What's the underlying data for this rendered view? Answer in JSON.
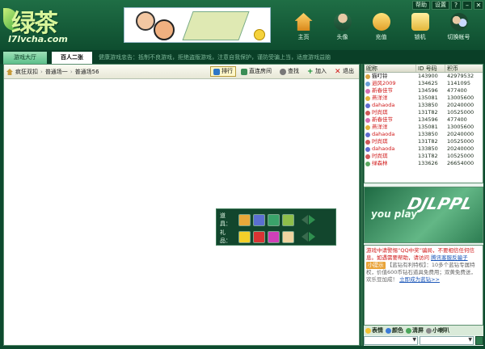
{
  "header": {
    "logo_text": "绿茶",
    "logo_url": "l7lvcha.com",
    "top_buttons": [
      "帮助",
      "设置"
    ],
    "window_controls": [
      "?",
      "–",
      "✕"
    ],
    "nav": [
      {
        "label": "主页",
        "icon": "home-icon"
      },
      {
        "label": "头像",
        "icon": "avatar-icon"
      },
      {
        "label": "充值",
        "icon": "money-bag-icon"
      },
      {
        "label": "锁机",
        "icon": "lock-icon"
      },
      {
        "label": "切换帐号",
        "icon": "switch-account-icon"
      }
    ]
  },
  "tabs": {
    "lobby": "游戏大厅",
    "current": "百人二张",
    "notice": "健康游戏忠告：抵制不良游戏，拒绝盗版游戏，注意自我保护，谨防受骗上当，适度游戏益脑"
  },
  "breadcrumb": [
    "疯狂双扣",
    "普通场一",
    "普通场56"
  ],
  "toolbar": {
    "rank": "排行",
    "direct_join": "直连房间",
    "find": "查找",
    "add": "加入",
    "exit": "退出"
  },
  "items": {
    "props_label": "道具：",
    "gifts_label": "礼品：",
    "props_colors": [
      "#e9a83a",
      "#5a6fd1",
      "#3aa36a",
      "#8fbf4a"
    ],
    "gifts_colors": [
      "#f3d02a",
      "#d83434",
      "#d040b8",
      "#f0d4a0"
    ]
  },
  "players": {
    "columns": [
      "昵称",
      "ID 号码",
      "积币"
    ],
    "rows": [
      {
        "name": "猫叮铃",
        "id": "143900",
        "coins": "42979532",
        "color": "#000000",
        "av": "#d9a444"
      },
      {
        "name": "逍风2009",
        "id": "134625",
        "coins": "1141095",
        "color": "#d01818",
        "av": "#6aa0d8"
      },
      {
        "name": "新春佳节",
        "id": "134596",
        "coins": "477400",
        "color": "#d01818",
        "av": "#d56fb0"
      },
      {
        "name": "燕洋洋",
        "id": "135081",
        "coins": "13005600",
        "color": "#d01818",
        "av": "#e3b23a"
      },
      {
        "name": "dahaoda",
        "id": "133850",
        "coins": "20240000",
        "color": "#d01818",
        "av": "#5f6bcf"
      },
      {
        "name": "时尚琪",
        "id": "131T82",
        "coins": "10525000",
        "color": "#d01818",
        "av": "#cf5a5a"
      },
      {
        "name": "新春佳节",
        "id": "134596",
        "coins": "477400",
        "color": "#d01818",
        "av": "#d56fb0"
      },
      {
        "name": "燕洋洋",
        "id": "135081",
        "coins": "13005600",
        "color": "#d01818",
        "av": "#e3b23a"
      },
      {
        "name": "dahaoda",
        "id": "133850",
        "coins": "20240000",
        "color": "#d01818",
        "av": "#5f6bcf"
      },
      {
        "name": "时尚琪",
        "id": "131T82",
        "coins": "10525000",
        "color": "#d01818",
        "av": "#cf5a5a"
      },
      {
        "name": "dahaoda",
        "id": "133850",
        "coins": "20240000",
        "color": "#d01818",
        "av": "#5f6bcf"
      },
      {
        "name": "时尚琪",
        "id": "131T82",
        "coins": "10525000",
        "color": "#d01818",
        "av": "#cf5a5a"
      },
      {
        "name": "绿森林",
        "id": "133626",
        "coins": "26654000",
        "color": "#d01818",
        "av": "#5aa860"
      }
    ]
  },
  "ad": {
    "line1": "you play",
    "line2": "DJLPPL"
  },
  "chat": {
    "warning": "游戏中请警惕“QQ中奖”骗局，不要相信任何信息。如遇需要帮助，请访问",
    "link1": "腾讯客服反骗子",
    "badge": "小提示",
    "tip_prefix": "【蓝钻有利特权】：10多个蓝钻专属特权，价值600币钻石道具免费用；双黄免费送，",
    "tip_suffix": "欢乐豆加成！",
    "link2": "立即成为蓝钻>>"
  },
  "chat_tools": [
    "表情",
    "颜色",
    "清屏",
    "小喇叭"
  ]
}
